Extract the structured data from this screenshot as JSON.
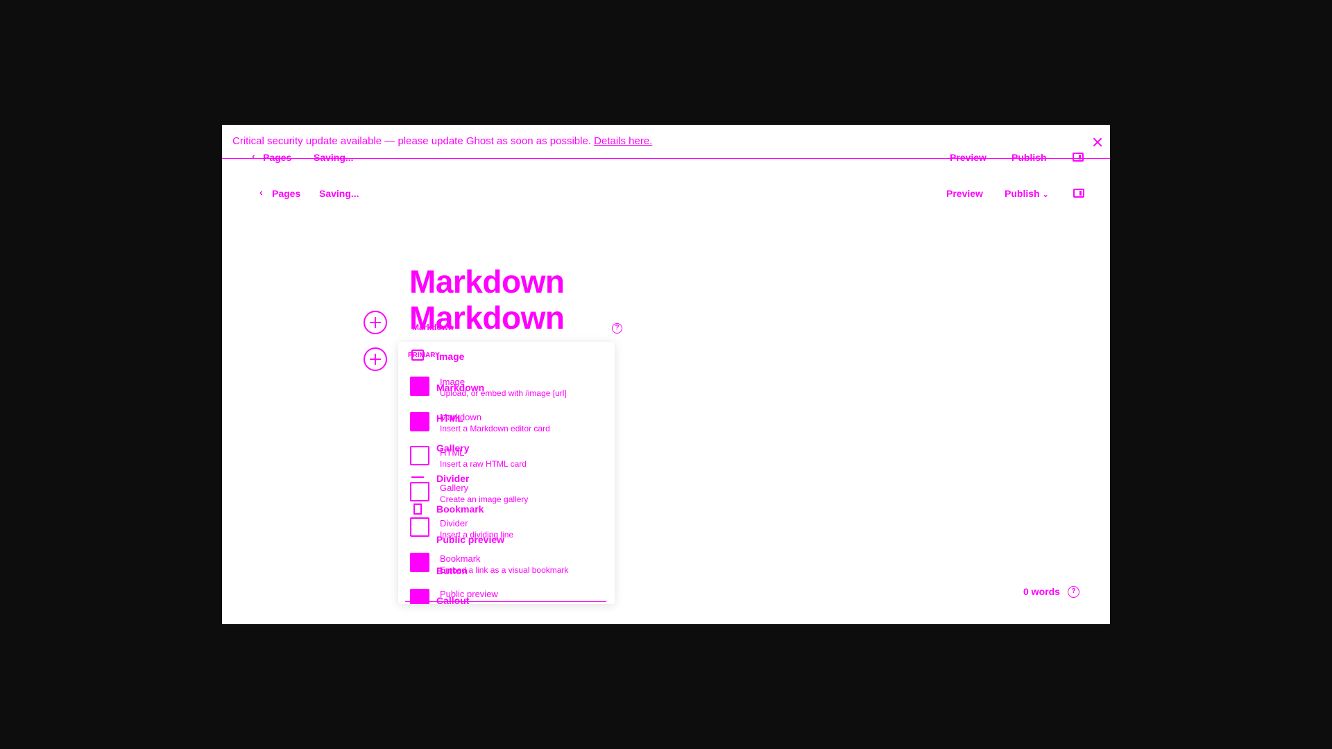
{
  "banner": {
    "text": "Critical security update available — please update Ghost as soon as possible.",
    "link": "Details here."
  },
  "header": {
    "back_label": "Pages",
    "status": "Saving...",
    "preview_label": "Preview",
    "publish_label": "Publish"
  },
  "editor": {
    "title_line1": "Markdown",
    "title_line2": "Markdown",
    "ghost_label": "Markdown"
  },
  "card_menu": {
    "section_label": "PRIMARY",
    "items": [
      {
        "label": "Image",
        "desc": "Upload, or embed with /image [url]",
        "icon": "image-icon"
      },
      {
        "label": "Markdown",
        "desc": "Insert a Markdown editor card",
        "icon": "markdown-icon"
      },
      {
        "label": "HTML",
        "desc": "Insert a raw HTML card",
        "icon": "html-icon"
      },
      {
        "label": "Gallery",
        "desc": "Create an image gallery",
        "icon": "gallery-icon"
      },
      {
        "label": "Divider",
        "desc": "Insert a dividing line",
        "icon": "divider-icon"
      },
      {
        "label": "Bookmark",
        "desc": "Embed a link as a visual bookmark",
        "icon": "bookmark-icon"
      },
      {
        "label": "Public preview",
        "desc": "",
        "icon": "eye-icon"
      }
    ],
    "ghost_items": [
      "Image",
      "Markdown",
      "HTML",
      "Gallery",
      "Divider",
      "Bookmark",
      "Public preview",
      "Button",
      "Callout"
    ]
  },
  "footer": {
    "word_count": "0 words"
  },
  "colors": {
    "accent": "#ff00ff",
    "backdrop": "#0d0d0e",
    "window": "#ffffff"
  }
}
